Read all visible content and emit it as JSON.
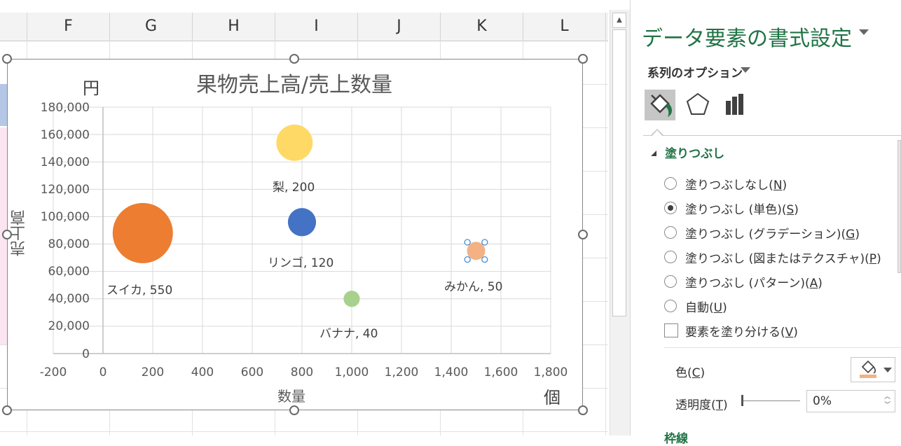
{
  "sheet": {
    "columns": [
      "F",
      "G",
      "H",
      "I",
      "J",
      "K",
      "L"
    ]
  },
  "chart": {
    "title": "果物売上高/売上数量",
    "y_unit": "円",
    "x_unit": "個",
    "y_title": "売上高",
    "x_title": "数量",
    "y_ticks": [
      "180,000",
      "160,000",
      "140,000",
      "120,000",
      "100,000",
      "80,000",
      "60,000",
      "40,000",
      "20,000",
      "0"
    ],
    "x_ticks": [
      "-200",
      "0",
      "200",
      "400",
      "600",
      "800",
      "1,000",
      "1,200",
      "1,400",
      "1,600",
      "1,800"
    ],
    "bubble_labels": [
      "梨, 200",
      "スイカ, 550",
      "リンゴ, 120",
      "みかん, 50",
      "バナナ, 40"
    ]
  },
  "chart_data": {
    "type": "scatter",
    "subtype": "bubble",
    "title": "果物売上高/売上数量",
    "xlabel": "数量",
    "ylabel": "売上高",
    "xlim": [
      -200,
      1800
    ],
    "ylim": [
      0,
      180000
    ],
    "grid": true,
    "points": [
      {
        "label": "梨",
        "x": 770,
        "y": 154000,
        "size": 200,
        "color": "#ffd966"
      },
      {
        "label": "スイカ",
        "x": 160,
        "y": 88000,
        "size": 550,
        "color": "#ed7d31"
      },
      {
        "label": "リンゴ",
        "x": 800,
        "y": 96000,
        "size": 120,
        "color": "#4472c4"
      },
      {
        "label": "みかん",
        "x": 1500,
        "y": 75000,
        "size": 50,
        "color": "#f4b183"
      },
      {
        "label": "バナナ",
        "x": 1000,
        "y": 40000,
        "size": 40,
        "color": "#a9d18e"
      }
    ]
  },
  "pane": {
    "title": "データ要素の書式設定",
    "series_options": "系列のオプション",
    "fill_section": "塗りつぶし",
    "options": [
      {
        "text": "塗りつぶしなし(",
        "key": "N",
        "tail": ")",
        "checked": false
      },
      {
        "text": "塗りつぶし (単色)(",
        "key": "S",
        "tail": ")",
        "checked": true
      },
      {
        "text": "塗りつぶし (グラデーション)(",
        "key": "G",
        "tail": ")",
        "checked": false
      },
      {
        "text": "塗りつぶし (図またはテクスチャ)(",
        "key": "P",
        "tail": ")",
        "checked": false
      },
      {
        "text": "塗りつぶし (パターン)(",
        "key": "A",
        "tail": ")",
        "checked": false
      },
      {
        "text": "自動(",
        "key": "U",
        "tail": ")",
        "checked": false
      }
    ],
    "vary_colors": {
      "text": "要素を塗り分ける(",
      "key": "V",
      "tail": ")"
    },
    "color_label": {
      "text": "色(",
      "key": "C",
      "tail": ")"
    },
    "transparency_label": {
      "text": "透明度(",
      "key": "T",
      "tail": ")"
    },
    "transparency_value": "0%",
    "fill_color": "#f4b183",
    "accent": "#217346",
    "next_section": "枠線"
  }
}
